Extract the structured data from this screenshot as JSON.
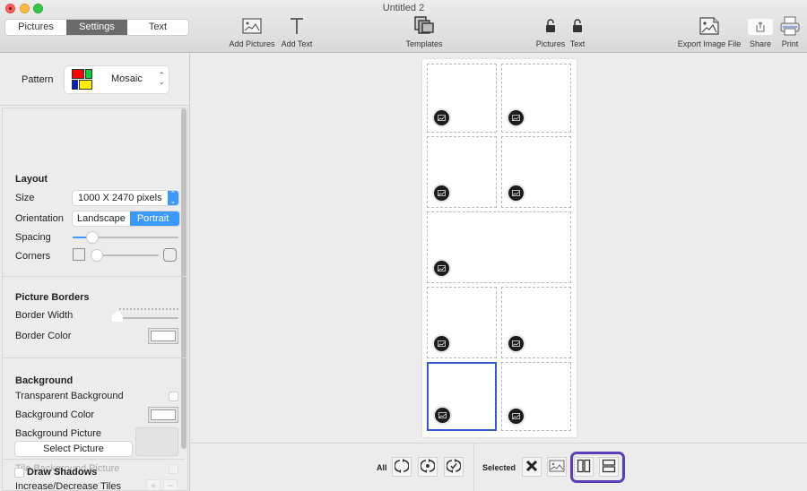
{
  "window": {
    "title": "Untitled 2"
  },
  "tabs": [
    {
      "label": "Pictures",
      "active": false
    },
    {
      "label": "Settings",
      "active": true
    },
    {
      "label": "Text",
      "active": false
    }
  ],
  "toolbar": {
    "add_pictures": {
      "label": "Add Pictures",
      "icon": "image-icon"
    },
    "add_text": {
      "label": "Add Text",
      "icon": "text-t-icon"
    },
    "templates": {
      "label": "Templates",
      "icon": "templates-icon"
    },
    "lock_pictures": {
      "label": "Pictures",
      "icon": "unlocked-padlock-icon"
    },
    "lock_text": {
      "label": "Text",
      "icon": "unlocked-padlock-icon"
    },
    "export": {
      "label": "Export Image File",
      "icon": "export-image-icon"
    },
    "share": {
      "label": "Share",
      "icon": "share-icon"
    },
    "print": {
      "label": "Print",
      "icon": "printer-icon"
    }
  },
  "sidebar": {
    "pattern": {
      "label": "Pattern",
      "value": "Mosaic",
      "swatch_colors": [
        "#ff0000",
        "#00cc33",
        "#0022cc",
        "#ffee00"
      ]
    },
    "layout": {
      "title": "Layout",
      "size_label": "Size",
      "size_value": "1000 X 2470 pixels",
      "orientation_label": "Orientation",
      "orientation_options": [
        "Landscape",
        "Portrait"
      ],
      "orientation_selected": "Portrait",
      "spacing_label": "Spacing",
      "spacing_value_fraction": 0.19,
      "corners_label": "Corners",
      "corners_value_fraction": 0.0
    },
    "picture_borders": {
      "title": "Picture Borders",
      "border_width_label": "Border Width",
      "border_width_value_fraction": 0.0,
      "border_color_label": "Border Color",
      "border_color": "#ffffff"
    },
    "background": {
      "title": "Background",
      "transparent_label": "Transparent Background",
      "transparent_checked": false,
      "color_label": "Background Color",
      "color": "#ffffff",
      "picture_label": "Background Picture",
      "select_picture_button": "Select Picture",
      "tile_label": "Tile Background Picture",
      "tile_checked": false,
      "tiles_label": "Increase/Decrease Tiles",
      "plus": "+",
      "minus": "−"
    },
    "shadows": {
      "label": "Draw Shadows",
      "checked": false
    }
  },
  "canvas": {
    "cells": [
      {
        "row": 1,
        "col": 1,
        "span": 1,
        "selected": false
      },
      {
        "row": 1,
        "col": 2,
        "span": 1,
        "selected": false
      },
      {
        "row": 2,
        "col": 1,
        "span": 1,
        "selected": false
      },
      {
        "row": 2,
        "col": 2,
        "span": 1,
        "selected": false
      },
      {
        "row": 3,
        "col": 1,
        "span": 2,
        "selected": false
      },
      {
        "row": 4,
        "col": 1,
        "span": 1,
        "selected": false
      },
      {
        "row": 4,
        "col": 2,
        "span": 1,
        "selected": false
      },
      {
        "row": 5,
        "col": 1,
        "span": 1,
        "selected": true
      },
      {
        "row": 5,
        "col": 2,
        "span": 1,
        "selected": false
      }
    ],
    "selection_color": "#3459c8"
  },
  "bottom_bar": {
    "all_label": "All",
    "all_buttons": [
      "rotate-icon",
      "rotate-center-icon",
      "rotate-check-icon"
    ],
    "selected_label": "Selected",
    "selected_buttons": [
      "delete-x-icon",
      "image-icon",
      "split-vertical-icon",
      "split-horizontal-icon"
    ],
    "highlight_color": "#5c3fb6"
  }
}
